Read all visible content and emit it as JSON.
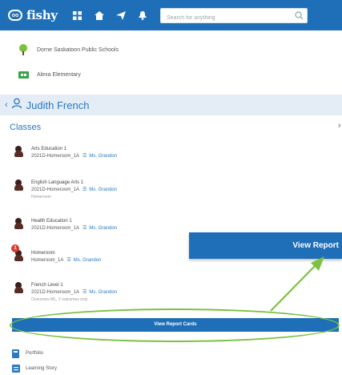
{
  "topbar": {
    "logo_text": "fishy",
    "search_placeholder": "Search for anything",
    "icons": [
      "grid-icon",
      "home-icon",
      "send-icon",
      "bell-icon"
    ]
  },
  "schools": [
    {
      "label": "Dorne Saskatoon Public Schools",
      "icon": "school-tree-icon"
    },
    {
      "label": "Alexa Elementary",
      "icon": "school-building-icon"
    }
  ],
  "student": {
    "name": "Judith French"
  },
  "classes_heading": "Classes",
  "classes": [
    {
      "name": "Arts Education 1",
      "section": "2021D-Homeroom_1A",
      "teacher": "Ms. Grandon",
      "note": ""
    },
    {
      "name": "English Language Arts 1",
      "section": "2021D-Homeroom_1A",
      "teacher": "Ms. Grandon",
      "note": "Homeroom"
    },
    {
      "name": "Health Education 1",
      "section": "2021D-Homeroom_1A",
      "teacher": "Ms. Grandon",
      "note": ""
    },
    {
      "name": "Homeroom",
      "section": "Homeroom_1A",
      "teacher": "Ms. Grandon",
      "note": "",
      "badge": "1"
    },
    {
      "name": "French Level 1",
      "section": "2021D-Homeroom_1A",
      "teacher": "Ms. Grandon",
      "note": "Outcomes ML, 2 outcomes only"
    }
  ],
  "report_button": "View Report Cards",
  "callout": "View Report",
  "links": [
    {
      "label": "Portfolio",
      "icon": "portfolio-icon"
    },
    {
      "label": "Learning Story",
      "icon": "learning-story-icon"
    }
  ],
  "colors": {
    "primary": "#1f6fb8",
    "highlight": "#7cc242",
    "badge": "#d83a2d"
  }
}
